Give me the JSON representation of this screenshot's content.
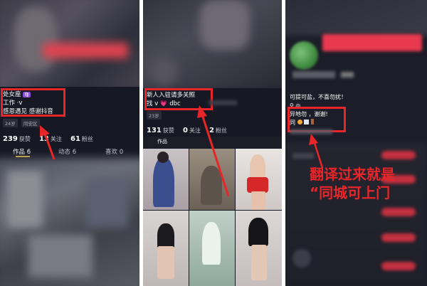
{
  "panel1": {
    "bio_line1": "处女座",
    "bio_line2": "工作 ·v",
    "bio_line3": "感恩遇见 感谢抖音",
    "tags": [
      "24岁",
      "同安区"
    ],
    "stats": [
      {
        "value": "239",
        "label": "获赞"
      },
      {
        "value": "13",
        "label": "关注"
      },
      {
        "value": "61",
        "label": "粉丝"
      }
    ],
    "tabs": [
      "作品 6",
      "动态 6",
      "喜欢 0"
    ]
  },
  "panel2": {
    "bio_line1": "新人入驻请多关照",
    "bio_line2": "找  v    💗    dbc",
    "tag": "23岁",
    "stats": [
      {
        "value": "131",
        "label": "获赞"
      },
      {
        "value": "0",
        "label": "关注"
      },
      {
        "value": "2",
        "label": "粉丝"
      }
    ],
    "tab_label": "作品"
  },
  "panel3": {
    "bio_line1": "可提可盐，不喜勿扰！",
    "bio_line2": "♀ ◎",
    "bio_line3": "异地勿 ，谢谢!",
    "bio_line4": "同",
    "annotation_line1": "翻译过来就是",
    "annotation_line2": "“同城可上门"
  },
  "colors": {
    "annotation_red": "#e8262a",
    "app_dark": "#161823",
    "follow_button": "#e8394f"
  }
}
